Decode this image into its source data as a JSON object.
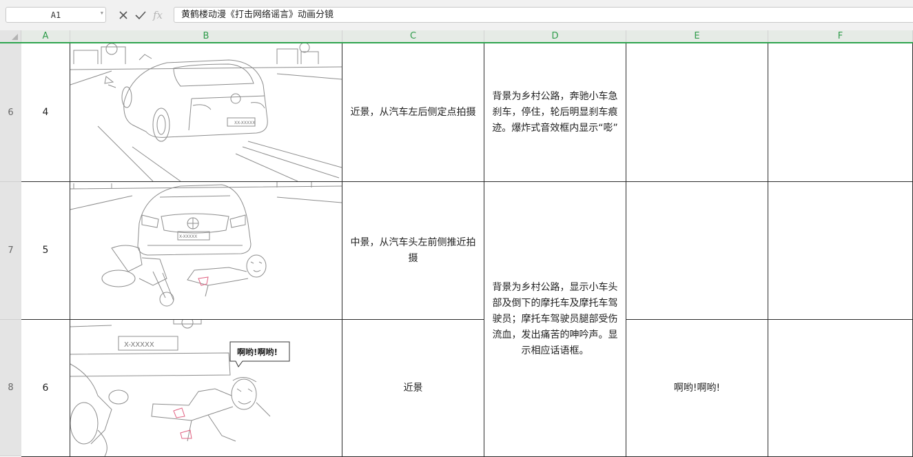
{
  "formula_bar": {
    "name_box": "A1",
    "fx_label": "fx",
    "content": "黄鹤楼动漫《打击网络谣言》动画分镜"
  },
  "columns": [
    "A",
    "B",
    "C",
    "D",
    "E",
    "F"
  ],
  "rows": [
    {
      "row_number": "6",
      "shot": "4",
      "shot_type": "近景，从汽车左后侧定点拍摄",
      "description": "背景为乡村公路，奔驰小车急刹车，停住，轮后明显刹车痕迹。爆炸式音效框内显示“嘭”",
      "dialogue": "",
      "notes": ""
    },
    {
      "row_number": "7",
      "shot": "5",
      "shot_type": "中景，从汽车头左前侧推近拍摄",
      "notes": ""
    },
    {
      "row_number": "8",
      "shot": "6",
      "shot_type": "近景",
      "dialogue": "啊哟!啊哟!",
      "notes": ""
    }
  ],
  "merged_description_7_8": "背景为乡村公路，显示小车头部及倒下的摩托车及摩托车驾驶员；摩托车驾驶员腿部受伤流血，发出痛苦的呻吟声。显示相应话语框。",
  "images": {
    "frame_4_plate": "XX-XXXXX",
    "frame_5_plate": "X-XXXXX",
    "frame_6_plate": "X-XXXXX",
    "frame_6_bubble": "啊哟!啊哟!"
  },
  "colors": {
    "header_green": "#2e9b4a",
    "sketch_line": "#8a8a8a",
    "blood": "#e06080"
  }
}
